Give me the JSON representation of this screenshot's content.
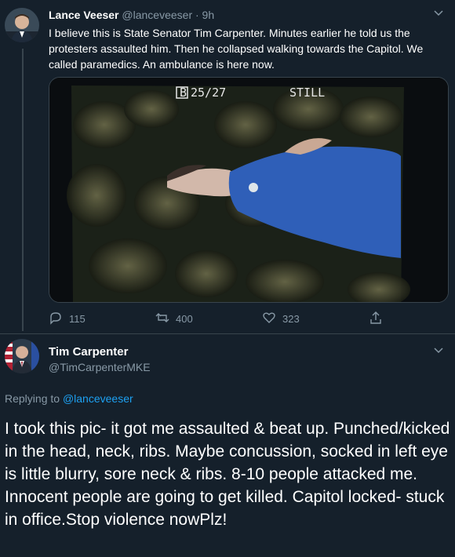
{
  "colors": {
    "background": "#15202b",
    "muted": "#8899a6",
    "link": "#1da1f2",
    "divider": "#38444d"
  },
  "tweet1": {
    "author_name": "Lance Veeser",
    "author_handle": "@lanceveeser",
    "time": "· 9h",
    "text": "I believe this is State Senator Tim Carpenter. Minutes earlier he told us the protesters assaulted him. Then he collapsed walking towards the Capitol. We called paramedics. An ambulance is here now.",
    "photo_overlay": {
      "counter": "25/27",
      "mode": "STILL"
    },
    "actions": {
      "reply_count": "115",
      "retweet_count": "400",
      "like_count": "323"
    },
    "icons": [
      "reply-icon",
      "retweet-icon",
      "like-icon",
      "share-icon",
      "chevron-down-icon"
    ]
  },
  "tweet2": {
    "author_name": "Tim Carpenter",
    "author_handle": "@TimCarpenterMKE",
    "replying_prefix": "Replying to",
    "replying_handle": "@lanceveeser",
    "text": "I took this pic- it got me assaulted & beat up. Punched/kicked in the head, neck, ribs. Maybe concussion, socked in left eye is little blurry, sore neck & ribs. 8-10 people attacked me. Innocent people are going to get killed. Capitol locked- stuck in office.Stop violence nowPlz!"
  }
}
